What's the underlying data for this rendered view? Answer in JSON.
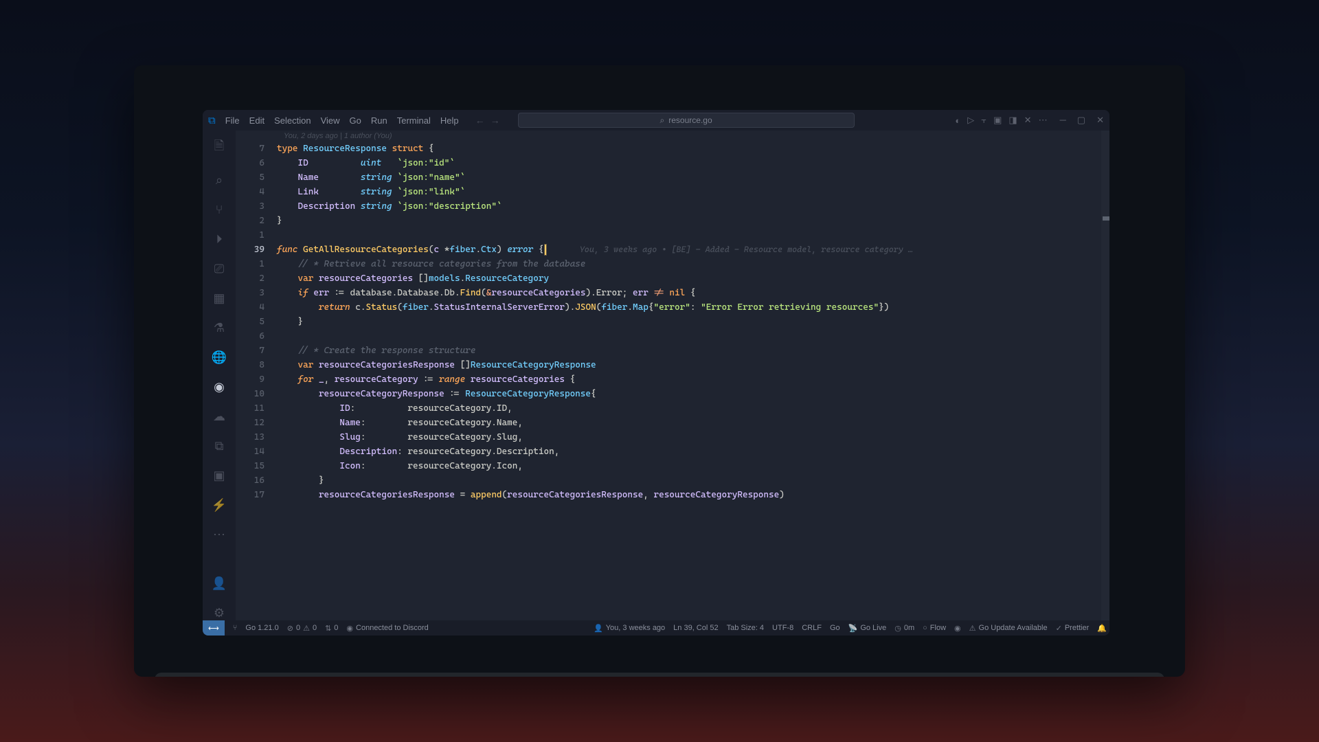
{
  "titlebar": {
    "menu": [
      "File",
      "Edit",
      "Selection",
      "View",
      "Go",
      "Run",
      "Terminal",
      "Help"
    ],
    "search_label": "resource.go"
  },
  "blame_top": "You, 2 days ago | 1 author (You)",
  "blame_inline": "You, 3 weeks ago • [BE] - Added - Resource model, resource category …",
  "gutter": [
    "7",
    "6",
    "5",
    "4",
    "3",
    "2",
    "1",
    "39",
    "1",
    "2",
    "3",
    "4",
    "5",
    "6",
    "7",
    "8",
    "9",
    "10",
    "11",
    "12",
    "13",
    "14",
    "15",
    "16",
    "17"
  ],
  "code": {
    "l0": [
      [
        "kw",
        "type"
      ],
      [
        "pu",
        " "
      ],
      [
        "ty",
        "ResourceResponse"
      ],
      [
        "pu",
        " "
      ],
      [
        "kw",
        "struct"
      ],
      [
        "pu",
        " {"
      ]
    ],
    "l1": [
      [
        "pu",
        "    "
      ],
      [
        "vr",
        "ID"
      ],
      [
        "pu",
        "          "
      ],
      [
        "tyi",
        "uint"
      ],
      [
        "pu",
        "   "
      ],
      [
        "str",
        "`json:\"id\"`"
      ]
    ],
    "l2": [
      [
        "pu",
        "    "
      ],
      [
        "vr",
        "Name"
      ],
      [
        "pu",
        "        "
      ],
      [
        "tyi",
        "string"
      ],
      [
        "pu",
        " "
      ],
      [
        "str",
        "`json:\"name\"`"
      ]
    ],
    "l3": [
      [
        "pu",
        "    "
      ],
      [
        "vr",
        "Link"
      ],
      [
        "pu",
        "        "
      ],
      [
        "tyi",
        "string"
      ],
      [
        "pu",
        " "
      ],
      [
        "str",
        "`json:\"link\"`"
      ]
    ],
    "l4": [
      [
        "pu",
        "    "
      ],
      [
        "vr",
        "Description"
      ],
      [
        "pu",
        " "
      ],
      [
        "tyi",
        "string"
      ],
      [
        "pu",
        " "
      ],
      [
        "str",
        "`json:\"description\"`"
      ]
    ],
    "l5": [
      [
        "pu",
        "}"
      ]
    ],
    "l6": [
      [
        "",
        "  "
      ]
    ],
    "l7": [
      [
        "kwf",
        "func"
      ],
      [
        "pu",
        " "
      ],
      [
        "fn",
        "GetAllResourceCategories"
      ],
      [
        "pu",
        "("
      ],
      [
        "vr",
        "c"
      ],
      [
        "pu",
        " *"
      ],
      [
        "ty",
        "fiber"
      ],
      [
        "pu",
        "."
      ],
      [
        "ty",
        "Ctx"
      ],
      [
        "pu",
        ") "
      ],
      [
        "tyi",
        "error"
      ],
      [
        "pu",
        " {"
      ]
    ],
    "l8": [
      [
        "pu",
        "    "
      ],
      [
        "cm",
        "// * Retrieve all resource categories from the database"
      ]
    ],
    "l9": [
      [
        "pu",
        "    "
      ],
      [
        "kw",
        "var"
      ],
      [
        "pu",
        " "
      ],
      [
        "vr",
        "resourceCategories"
      ],
      [
        "pu",
        " []"
      ],
      [
        "ty",
        "models"
      ],
      [
        "pu",
        "."
      ],
      [
        "ty",
        "ResourceCategory"
      ]
    ],
    "l10": [
      [
        "pu",
        "    "
      ],
      [
        "kwf",
        "if"
      ],
      [
        "pu",
        " "
      ],
      [
        "vr",
        "err"
      ],
      [
        "pu",
        " := database.Database.Db."
      ],
      [
        "fn",
        "Find"
      ],
      [
        "pu",
        "("
      ],
      [
        "op",
        "&"
      ],
      [
        "vr",
        "resourceCategories"
      ],
      [
        "pu",
        ").Error; "
      ],
      [
        "vr",
        "err"
      ],
      [
        "pu",
        " "
      ],
      [
        "op",
        "!="
      ],
      [
        "pu",
        " "
      ],
      [
        "kw",
        "nil"
      ],
      [
        "pu",
        " {"
      ]
    ],
    "l11": [
      [
        "pu",
        "        "
      ],
      [
        "kwf",
        "return"
      ],
      [
        "pu",
        " c."
      ],
      [
        "fn",
        "Status"
      ],
      [
        "pu",
        "("
      ],
      [
        "ty",
        "fiber"
      ],
      [
        "pu",
        "."
      ],
      [
        "vr",
        "StatusInternalServerError"
      ],
      [
        "pu",
        ")."
      ],
      [
        "fn",
        "JSON"
      ],
      [
        "pu",
        "("
      ],
      [
        "ty",
        "fiber"
      ],
      [
        "pu",
        "."
      ],
      [
        "ty",
        "Map"
      ],
      [
        "pu",
        "{"
      ],
      [
        "str",
        "\"error\""
      ],
      [
        "pu",
        ": "
      ],
      [
        "str",
        "\"Error Error retrieving resources\""
      ],
      [
        "pu",
        "})"
      ]
    ],
    "l12": [
      [
        "pu",
        "    }"
      ]
    ],
    "l13": [
      [
        "",
        "  "
      ]
    ],
    "l14": [
      [
        "pu",
        "    "
      ],
      [
        "cm",
        "// * Create the response structure"
      ]
    ],
    "l15": [
      [
        "pu",
        "    "
      ],
      [
        "kw",
        "var"
      ],
      [
        "pu",
        " "
      ],
      [
        "vr",
        "resourceCategoriesResponse"
      ],
      [
        "pu",
        " []"
      ],
      [
        "ty",
        "ResourceCategoryResponse"
      ]
    ],
    "l16": [
      [
        "pu",
        "    "
      ],
      [
        "kwf",
        "for"
      ],
      [
        "pu",
        " "
      ],
      [
        "vr",
        "_"
      ],
      [
        "pu",
        ", "
      ],
      [
        "vr",
        "resourceCategory"
      ],
      [
        "pu",
        " := "
      ],
      [
        "kwf",
        "range"
      ],
      [
        "pu",
        " "
      ],
      [
        "vr",
        "resourceCategories"
      ],
      [
        "pu",
        " {"
      ]
    ],
    "l17": [
      [
        "pu",
        "        "
      ],
      [
        "vr",
        "resourceCategoryResponse"
      ],
      [
        "pu",
        " := "
      ],
      [
        "ty",
        "ResourceCategoryResponse"
      ],
      [
        "pu",
        "{"
      ]
    ],
    "l18": [
      [
        "pu",
        "            "
      ],
      [
        "vr",
        "ID"
      ],
      [
        "pu",
        ":          resourceCategory.ID,"
      ]
    ],
    "l19": [
      [
        "pu",
        "            "
      ],
      [
        "vr",
        "Name"
      ],
      [
        "pu",
        ":        resourceCategory.Name,"
      ]
    ],
    "l20": [
      [
        "pu",
        "            "
      ],
      [
        "vr",
        "Slug"
      ],
      [
        "pu",
        ":        resourceCategory.Slug,"
      ]
    ],
    "l21": [
      [
        "pu",
        "            "
      ],
      [
        "vr",
        "Description"
      ],
      [
        "pu",
        ": resourceCategory.Description,"
      ]
    ],
    "l22": [
      [
        "pu",
        "            "
      ],
      [
        "vr",
        "Icon"
      ],
      [
        "pu",
        ":        resourceCategory.Icon,"
      ]
    ],
    "l23": [
      [
        "pu",
        "        "
      ],
      [
        "pu",
        "}"
      ]
    ],
    "l24": [
      [
        "pu",
        "        "
      ],
      [
        "vr",
        "resourceCategoriesResponse"
      ],
      [
        "pu",
        " = "
      ],
      [
        "fn",
        "append"
      ],
      [
        "pu",
        "("
      ],
      [
        "vr",
        "resourceCategoriesResponse"
      ],
      [
        "pu",
        ", "
      ],
      [
        "vr",
        "resourceCategoryResponse"
      ],
      [
        "pu",
        ")"
      ]
    ]
  },
  "status": {
    "go_version": "Go 1.21.0",
    "errors": "0",
    "warnings": "0",
    "ports": "0",
    "discord": "Connected to Discord",
    "blame": "You, 3 weeks ago",
    "cursor": "Ln 39, Col 52",
    "tabsize": "Tab Size: 4",
    "encoding": "UTF-8",
    "eol": "CRLF",
    "lang": "Go",
    "golive": "Go Live",
    "time": "0m",
    "flow": "Flow",
    "update": "Go Update Available",
    "prettier": "Prettier"
  }
}
